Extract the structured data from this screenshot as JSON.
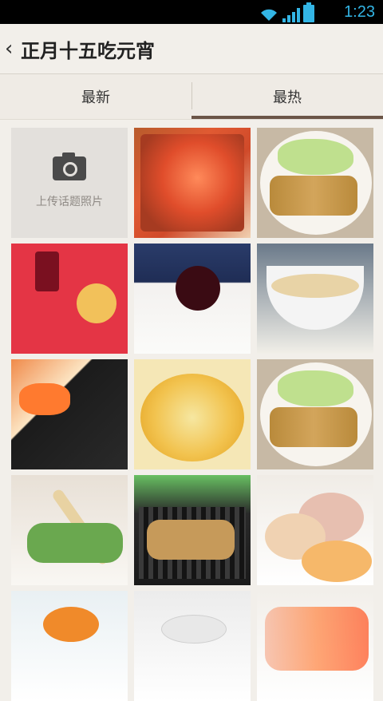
{
  "status": {
    "time": "1:23"
  },
  "header": {
    "title": "正月十五吃元宵"
  },
  "tabs": [
    {
      "label": "最新",
      "active": false
    },
    {
      "label": "最热",
      "active": true
    }
  ],
  "upload": {
    "label": "上传话题照片"
  }
}
